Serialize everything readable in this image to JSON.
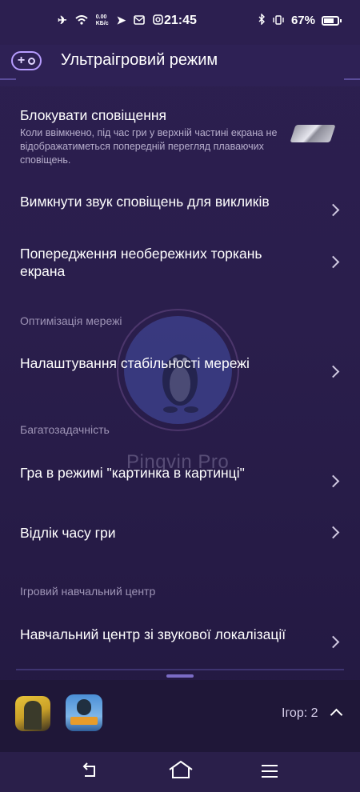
{
  "status_bar": {
    "time": "21:45",
    "speed_value": "0.00",
    "speed_unit": "KБ/с",
    "battery": "67%"
  },
  "header": {
    "title": "Ультраігровий режим"
  },
  "items": {
    "block_notifications": {
      "title": "Блокувати сповіщення",
      "description": "Коли ввімкнено, під час гри у верхній частині екрана не відображатиметься попередній перегляд плаваючих сповіщень."
    },
    "mute_calls": {
      "title": "Вимкнути звук сповіщень для викликів"
    },
    "careless_touch": {
      "title": "Попередження необережних торкань екрана"
    },
    "network_stability": {
      "title": "Налаштування стабільності мережі"
    },
    "pip_game": {
      "title": "Гра в режимі \"картинка в картинці\""
    },
    "game_timer": {
      "title": "Відлік часу гри"
    },
    "sound_training": {
      "title": "Навчальний центр зі звукової локалізації"
    }
  },
  "sections": {
    "network": "Оптимізація мережі",
    "multitasking": "Багатозадачність",
    "training": "Ігровий навчальний центр"
  },
  "watermark": "Pingvin Pro",
  "bottom_panel": {
    "games_count": "Ігор: 2"
  },
  "colors": {
    "background": "#2a1f4a",
    "accent": "#b79cff",
    "section_text": "#9e94b6"
  }
}
